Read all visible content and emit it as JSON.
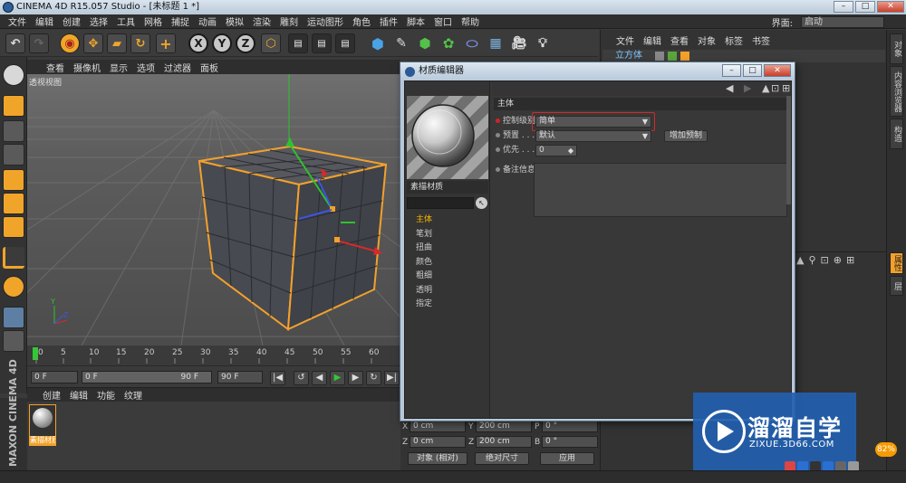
{
  "window": {
    "title": "CINEMA 4D R15.057 Studio - [未标题 1 *]"
  },
  "menubar": {
    "items": [
      "文件",
      "编辑",
      "创建",
      "选择",
      "工具",
      "网格",
      "捕捉",
      "动画",
      "模拟",
      "渲染",
      "雕刻",
      "运动图形",
      "角色",
      "插件",
      "脚本",
      "窗口",
      "帮助"
    ],
    "layout_label": "界面:",
    "layout_value": "启动"
  },
  "viewport": {
    "menu": [
      "查看",
      "摄像机",
      "显示",
      "选项",
      "过滤器",
      "面板"
    ],
    "title": "透视视图",
    "accent": "#f3a12b"
  },
  "timeline": {
    "ticks": [
      "0",
      "5",
      "10",
      "15",
      "20",
      "25",
      "30",
      "35",
      "40",
      "45",
      "50",
      "55",
      "60"
    ],
    "start": "0 F",
    "range_left": "0 F",
    "range_right": "90 F",
    "end": "90 F"
  },
  "material_manager": {
    "menu": [
      "创建",
      "编辑",
      "功能",
      "纹理"
    ],
    "material_label": "素描材质"
  },
  "object_manager": {
    "menu": [
      "文件",
      "编辑",
      "查看",
      "对象",
      "标签",
      "书签"
    ],
    "object_name": "立方体"
  },
  "coordinates": {
    "rows": [
      {
        "axis": "X",
        "pos": "0 cm",
        "sizeAxis": "Y",
        "size": "200 cm",
        "rotAxis": "P",
        "rot": "0 °"
      },
      {
        "axis": "Z",
        "pos": "0 cm",
        "sizeAxis": "Z",
        "size": "200 cm",
        "rotAxis": "B",
        "rot": "0 °"
      }
    ],
    "mode_object": "对象 (相对)",
    "mode_size": "绝对尺寸",
    "apply": "应用"
  },
  "material_editor": {
    "title": "材质编辑器",
    "material_name": "素描材质",
    "channels": [
      "主体",
      "笔划",
      "扭曲",
      "颜色",
      "粗细",
      "透明",
      "指定"
    ],
    "active_channel": "主体",
    "section": "主体",
    "control_level_label": "控制级别",
    "control_level_value": "简单",
    "preset_label": "预置 . . . . .",
    "preset_value": "默认",
    "add_preset": "增加预制",
    "priority_label": "优先 . . . .",
    "priority_value": "0",
    "note_label": "备注信息"
  },
  "right_tabs": [
    "对象",
    "内容浏览器",
    "构造",
    "属性",
    "层"
  ],
  "watermark": {
    "title": "溜溜自学",
    "subtitle": "ZIXUE.3D66.COM"
  },
  "tray": {
    "badge": "82%"
  }
}
